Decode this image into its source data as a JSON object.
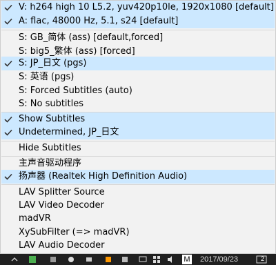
{
  "menu": {
    "items": [
      {
        "label": "V: h264 high 10 L5.2, yuv420p10le, 1920x1080 [default]",
        "checked": true
      },
      {
        "label": "A: flac, 48000 Hz, 5.1, s24 [default]",
        "checked": true
      },
      {
        "label": "S: GB_简体 (ass) [default,forced]",
        "checked": false
      },
      {
        "label": "S: big5_繁体 (ass) [forced]",
        "checked": false
      },
      {
        "label": "S: JP_日文 (pgs)",
        "checked": true
      },
      {
        "label": "S: 英语 (pgs)",
        "checked": false
      },
      {
        "label": "S: Forced Subtitles (auto)",
        "checked": false
      },
      {
        "label": "S: No subtitles",
        "checked": false
      },
      {
        "label": "Show Subtitles",
        "checked": true
      },
      {
        "label": "Undetermined, JP_日文",
        "checked": true
      },
      {
        "label": "Hide Subtitles",
        "checked": false
      },
      {
        "label": "主声音驱动程序",
        "checked": false
      },
      {
        "label": "扬声器 (Realtek High Definition Audio)",
        "checked": true
      },
      {
        "label": "LAV Splitter Source",
        "checked": false
      },
      {
        "label": "LAV Video Decoder",
        "checked": false
      },
      {
        "label": "madVR",
        "checked": false
      },
      {
        "label": "XySubFilter (=> madVR)",
        "checked": false
      },
      {
        "label": "LAV Audio Decoder",
        "checked": false
      }
    ]
  },
  "taskbar": {
    "date": "2017/09/23",
    "notification_count": "2"
  },
  "colors": {
    "check_accent": "#1f5fa8",
    "highlight": "#cce8ff"
  }
}
